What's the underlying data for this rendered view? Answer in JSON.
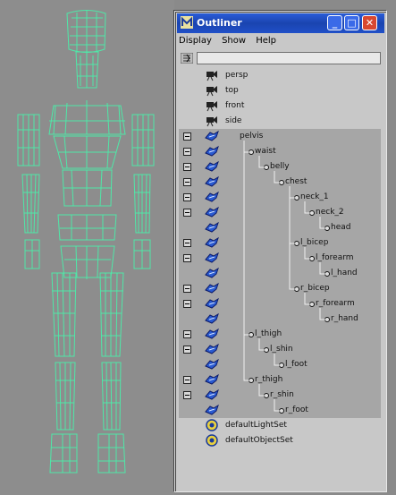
{
  "window": {
    "title": "Outliner",
    "buttons": {
      "minimize": "_",
      "maximize": "□",
      "close": "✕"
    }
  },
  "menu": [
    "Display",
    "Show",
    "Help"
  ],
  "filter": {
    "value": ""
  },
  "items": [
    {
      "label": "persp",
      "icon": "camera-icon",
      "depth": 0,
      "selected": false
    },
    {
      "label": "top",
      "icon": "camera-icon",
      "depth": 0,
      "selected": false
    },
    {
      "label": "front",
      "icon": "camera-icon",
      "depth": 0,
      "selected": false
    },
    {
      "label": "side",
      "icon": "camera-icon",
      "depth": 0,
      "selected": false
    },
    {
      "label": "pelvis",
      "icon": "joint-icon",
      "depth": 0,
      "selected": true,
      "expander": "collapse"
    },
    {
      "label": "waist",
      "icon": "joint-icon",
      "depth": 1,
      "selected": true,
      "expander": "collapse"
    },
    {
      "label": "belly",
      "icon": "joint-icon",
      "depth": 2,
      "selected": true,
      "expander": "collapse"
    },
    {
      "label": "chest",
      "icon": "joint-icon",
      "depth": 3,
      "selected": true,
      "expander": "collapse"
    },
    {
      "label": "neck_1",
      "icon": "joint-icon",
      "depth": 4,
      "selected": true,
      "expander": "collapse"
    },
    {
      "label": "neck_2",
      "icon": "joint-icon",
      "depth": 5,
      "selected": true,
      "expander": "collapse"
    },
    {
      "label": "head",
      "icon": "joint-icon",
      "depth": 6,
      "selected": true
    },
    {
      "label": "l_bicep",
      "icon": "joint-icon",
      "depth": 4,
      "selected": true,
      "expander": "collapse"
    },
    {
      "label": "l_forearm",
      "icon": "joint-icon",
      "depth": 5,
      "selected": true,
      "expander": "collapse"
    },
    {
      "label": "l_hand",
      "icon": "joint-icon",
      "depth": 6,
      "selected": true
    },
    {
      "label": "r_bicep",
      "icon": "joint-icon",
      "depth": 4,
      "selected": true,
      "expander": "collapse"
    },
    {
      "label": "r_forearm",
      "icon": "joint-icon",
      "depth": 5,
      "selected": true,
      "expander": "collapse"
    },
    {
      "label": "r_hand",
      "icon": "joint-icon",
      "depth": 6,
      "selected": true
    },
    {
      "label": "l_thigh",
      "icon": "joint-icon",
      "depth": 1,
      "selected": true,
      "expander": "collapse"
    },
    {
      "label": "l_shin",
      "icon": "joint-icon",
      "depth": 2,
      "selected": true,
      "expander": "collapse"
    },
    {
      "label": "l_foot",
      "icon": "joint-icon",
      "depth": 3,
      "selected": true
    },
    {
      "label": "r_thigh",
      "icon": "joint-icon",
      "depth": 1,
      "selected": true,
      "expander": "collapse"
    },
    {
      "label": "r_shin",
      "icon": "joint-icon",
      "depth": 2,
      "selected": true,
      "expander": "collapse"
    },
    {
      "label": "r_foot",
      "icon": "joint-icon",
      "depth": 3,
      "selected": true
    },
    {
      "label": "defaultLightSet",
      "icon": "set-icon",
      "depth": 0,
      "selected": false
    },
    {
      "label": "defaultObjectSet",
      "icon": "set-icon",
      "depth": 0,
      "selected": false
    }
  ],
  "colors": {
    "wireframe": "#4fe8a8",
    "viewport_bg": "#8d8d8d",
    "selection": "#a6a6a6",
    "title_bar": "#1a44b0",
    "joint_icon": "#2a5ad0"
  }
}
